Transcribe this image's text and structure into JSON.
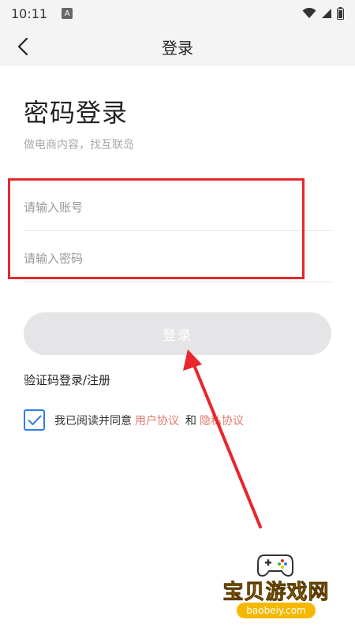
{
  "status_bar": {
    "time": "10:11",
    "notification_letter": "A"
  },
  "nav": {
    "title": "登录"
  },
  "page": {
    "heading": "密码登录",
    "subtitle": "做电商内容，找互联岛"
  },
  "form": {
    "account_placeholder": "请输入账号",
    "password_placeholder": "请输入密码",
    "account_value": "",
    "password_value": "",
    "login_button": "登录"
  },
  "links": {
    "sms_login": "验证码登录/注册"
  },
  "agreement": {
    "checked": true,
    "prefix": "我已阅读并同意",
    "user_agreement": "用户协议",
    "and": "和",
    "privacy_agreement": "隐私协议"
  },
  "watermark": {
    "title": "宝贝游戏网",
    "url": "baobeiy.com"
  },
  "colors": {
    "highlight": "#e8262b",
    "checkbox": "#2f7ee6",
    "link": "#e07a6c",
    "button_disabled": "#e5e5e7"
  },
  "icons": {
    "back": "chevron-left-icon",
    "wifi": "wifi-icon",
    "signal": "signal-icon",
    "battery": "battery-icon",
    "check": "check-icon"
  }
}
